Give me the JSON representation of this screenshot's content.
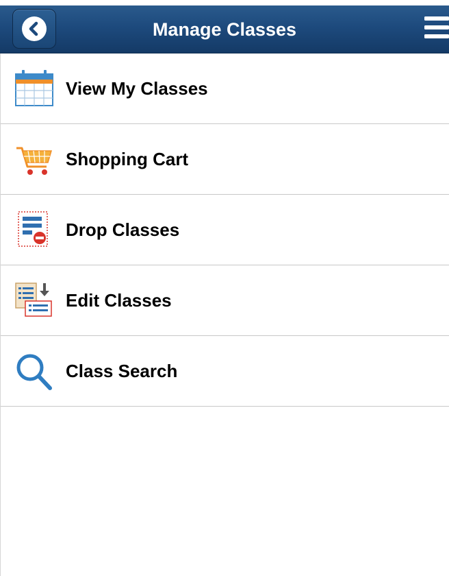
{
  "header": {
    "title": "Manage Classes",
    "back_icon": "chevron-left-icon",
    "menu_icon": "hamburger-menu-icon",
    "bar_color": "#1d4a7d"
  },
  "menu": {
    "items": [
      {
        "label": "View My Classes",
        "icon": "calendar-icon"
      },
      {
        "label": "Shopping Cart",
        "icon": "shopping-cart-icon"
      },
      {
        "label": "Drop Classes",
        "icon": "drop-classes-icon"
      },
      {
        "label": "Edit Classes",
        "icon": "edit-classes-icon"
      },
      {
        "label": "Class Search",
        "icon": "search-icon"
      }
    ]
  }
}
